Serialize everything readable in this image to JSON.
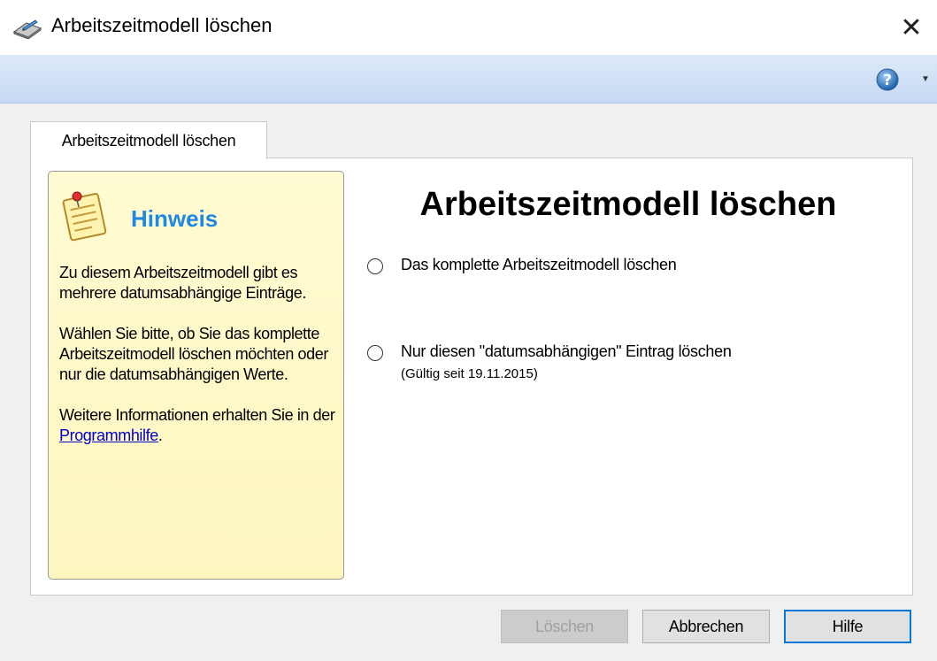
{
  "window": {
    "title": "Arbeitszeitmodell löschen",
    "close_symbol": "✕",
    "app_icon": "book-pen-icon"
  },
  "toolbar": {
    "help_icon": "help-icon",
    "help_symbol": "?",
    "dropdown_symbol": "▼"
  },
  "tab": {
    "label": "Arbeitszeitmodell löschen"
  },
  "hint": {
    "icon": "notepad-icon",
    "title": "Hinweis",
    "paragraph1": "Zu diesem Arbeitszeitmodell gibt es mehrere datumsabhängige Einträge.",
    "paragraph2": "Wählen Sie bitte, ob Sie das komplette Arbeitszeitmodell löschen möchten oder nur die datumsabhängigen Werte.",
    "paragraph3_prefix": "Weitere Informationen erhalten Sie in der ",
    "link": "Programmhilfe",
    "paragraph3_suffix": "."
  },
  "main": {
    "heading": "Arbeitszeitmodell löschen",
    "options": [
      {
        "label": "Das komplette Arbeitszeitmodell löschen",
        "selected": false
      },
      {
        "label": "Nur diesen \"datumsabhängigen\" Eintrag löschen",
        "sublabel": "(Gültig seit 19.11.2015)",
        "selected": false
      }
    ]
  },
  "buttons": {
    "delete": "Löschen",
    "cancel": "Abbrechen",
    "help": "Hilfe"
  },
  "colors": {
    "accent": "#0078d7",
    "hint_title": "#1e88e5",
    "hint_background": "#fffbd2",
    "toolbar": "#c6d9f3"
  }
}
